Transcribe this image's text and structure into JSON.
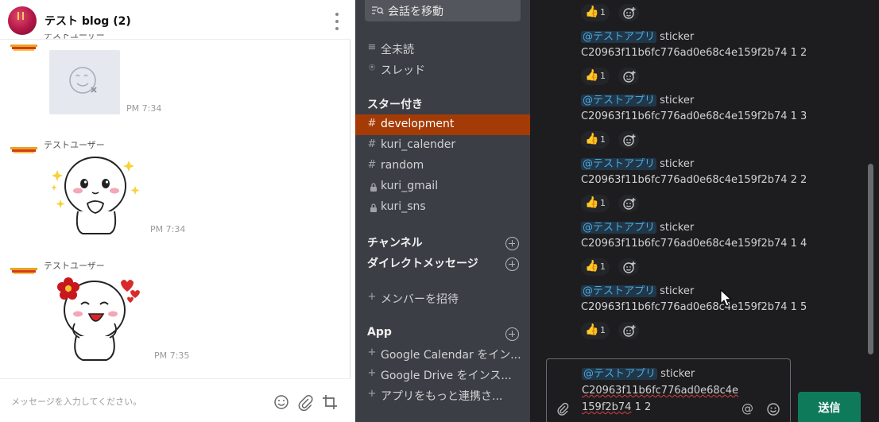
{
  "line_chat": {
    "title": "テスト blog (2)",
    "sender_name": "テストユーザー",
    "partial_sender": "テストユーザー",
    "messages": [
      {
        "type": "missing-sticker",
        "time": "PM 7:34"
      },
      {
        "type": "sticker-cony-shy",
        "sender": "テストユーザー",
        "time": "PM 7:34"
      },
      {
        "type": "sticker-cony-flower",
        "sender": "テストユーザー",
        "time": "PM 7:35"
      }
    ],
    "input_placeholder": "メッセージを入力してください。",
    "icons": [
      "emoji-icon",
      "paperclip-icon",
      "crop-icon",
      "kebab-menu-icon"
    ]
  },
  "slack_sidebar": {
    "jump_to": "会話を移動",
    "top_items": [
      {
        "icon": "list-icon",
        "label": "全未読"
      },
      {
        "icon": "thread-icon",
        "label": "スレッド"
      }
    ],
    "starred_title": "スター付き",
    "starred": [
      {
        "icon": "#",
        "label": "development",
        "active": true
      },
      {
        "icon": "#",
        "label": "kuri_calender",
        "active": false
      },
      {
        "icon": "#",
        "label": "random",
        "active": false
      },
      {
        "icon": "lock",
        "label": "kuri_gmail",
        "active": false
      },
      {
        "icon": "lock",
        "label": "kuri_sns",
        "active": false
      }
    ],
    "channels_title": "チャンネル",
    "dm_title": "ダイレクトメッセージ",
    "invite_label": "メンバーを招待",
    "app_title": "App",
    "apps": [
      {
        "label": "Google Calendar をイン..."
      },
      {
        "label": "Google Drive をインス..."
      },
      {
        "label": "アプリをもっと連携さ..."
      }
    ]
  },
  "slack_messages": {
    "reaction_emoji": "👍",
    "reaction_count": "1",
    "items": [
      {
        "mention": "@テストアプリ",
        "word": "sticker",
        "id": "C20963f11b6fc776ad0e68c4e159f2b74 1 2"
      },
      {
        "mention": "@テストアプリ",
        "word": "sticker",
        "id": "C20963f11b6fc776ad0e68c4e159f2b74 1 3"
      },
      {
        "mention": "@テストアプリ",
        "word": "sticker",
        "id": "C20963f11b6fc776ad0e68c4e159f2b74 2 2"
      },
      {
        "mention": "@テストアプリ",
        "word": "sticker",
        "id": "C20963f11b6fc776ad0e68c4e159f2b74 1 4"
      },
      {
        "mention": "@テストアプリ",
        "word": "sticker",
        "id": "C20963f11b6fc776ad0e68c4e159f2b74 1 5"
      }
    ]
  },
  "composer": {
    "mention": "@テストアプリ",
    "word": "sticker",
    "line2": "C20963f11b6fc776ad0e68c4e",
    "line3a": "159f2b74",
    "line3b": " 1 2",
    "at_symbol": "@",
    "send_label": "送信"
  },
  "colors": {
    "sidebar_bg": "#3b3e45",
    "active_item": "#a43b06",
    "main_bg": "#1d1d20",
    "mention": "#4fa8d9",
    "send_button": "#0f7a5a"
  }
}
